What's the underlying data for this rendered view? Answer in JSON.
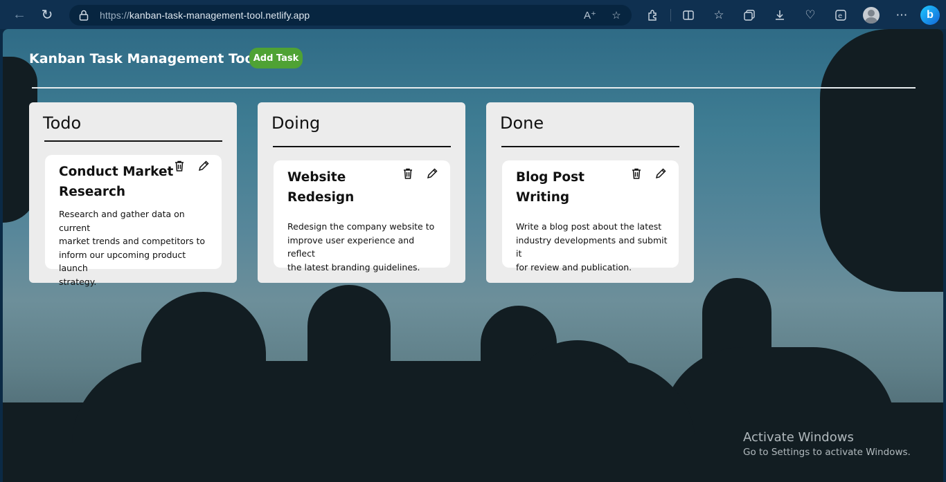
{
  "browser": {
    "url_prefix": "https://",
    "url_host": "kanban-task-management-tool.netlify.app",
    "icons": {
      "back": "back-arrow-icon",
      "reload": "reload-icon",
      "lock": "lock-icon",
      "read_aloud": "read-aloud-icon",
      "favorite": "star-icon",
      "extensions": "puzzle-icon",
      "split_screen": "split-screen-icon",
      "favorites": "favorites-icon",
      "collections": "collections-icon",
      "downloads": "download-icon",
      "performance": "heart-pulse-icon",
      "edge_bar": "edge-icon",
      "profile": "profile-avatar-icon",
      "more": "more-icon",
      "copilot": "bing-icon"
    }
  },
  "app": {
    "title": "Kanban Task Management Tool",
    "add_task_label": "Add Task",
    "accent_color": "#4fa234"
  },
  "columns": [
    {
      "title": "Todo",
      "cards": [
        {
          "title_line1": "Conduct Market",
          "title_line2": "Research",
          "description_lines": [
            "Research and gather data on current",
            "market trends and competitors to",
            "inform our upcoming product launch",
            "strategy."
          ]
        }
      ]
    },
    {
      "title": "Doing",
      "cards": [
        {
          "title_line1": "Website",
          "title_line2": "Redesign",
          "description_lines": [
            "Redesign the company website to",
            "improve user experience and reflect",
            "the latest branding guidelines."
          ]
        }
      ]
    },
    {
      "title": "Done",
      "cards": [
        {
          "title_line1": "Blog Post",
          "title_line2": "Writing",
          "description_lines": [
            "Write a blog post about the latest",
            "industry developments and submit it",
            "for review and publication."
          ]
        }
      ]
    }
  ],
  "watermark": {
    "line1": "Activate Windows",
    "line2": "Go to Settings to activate Windows."
  }
}
